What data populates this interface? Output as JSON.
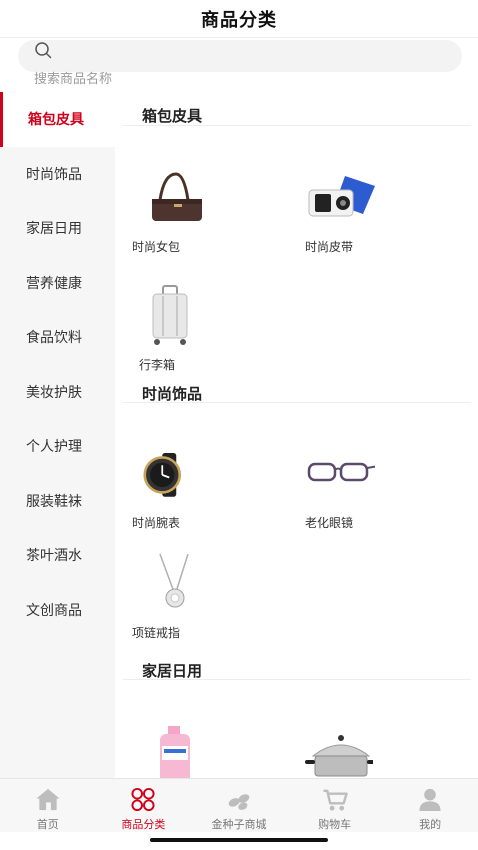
{
  "header": {
    "title": "商品分类"
  },
  "search": {
    "placeholder": "搜索商品名称"
  },
  "sidebar": {
    "items": [
      {
        "label": "箱包皮具",
        "active": true
      },
      {
        "label": "时尚饰品"
      },
      {
        "label": "家居日用"
      },
      {
        "label": "营养健康"
      },
      {
        "label": "食品饮料"
      },
      {
        "label": "美妆护肤"
      },
      {
        "label": "个人护理"
      },
      {
        "label": "服装鞋袜"
      },
      {
        "label": "茶叶酒水"
      },
      {
        "label": "文创商品"
      }
    ]
  },
  "sections": [
    {
      "title": "箱包皮具",
      "products": [
        {
          "label": "时尚女包",
          "icon": "handbag-icon"
        },
        {
          "label": "时尚皮带",
          "icon": "belt-icon"
        },
        {
          "label": "行李箱",
          "icon": "suitcase-icon"
        }
      ]
    },
    {
      "title": "时尚饰品",
      "products": [
        {
          "label": "时尚腕表",
          "icon": "watch-icon"
        },
        {
          "label": "老化眼镜",
          "icon": "glasses-icon"
        },
        {
          "label": "项链戒指",
          "icon": "necklace-icon"
        }
      ]
    },
    {
      "title": "家居日用",
      "products": [
        {
          "label": "",
          "icon": "detergent-bottle-icon"
        },
        {
          "label": "",
          "icon": "steamer-pot-icon"
        }
      ]
    }
  ],
  "tabbar": {
    "items": [
      {
        "label": "首页",
        "icon": "home-icon"
      },
      {
        "label": "商品分类",
        "icon": "category-icon",
        "active": true
      },
      {
        "label": "金种子商城",
        "icon": "seeds-icon"
      },
      {
        "label": "购物车",
        "icon": "cart-icon"
      },
      {
        "label": "我的",
        "icon": "user-icon"
      }
    ]
  },
  "colors": {
    "accent": "#d0021b",
    "sidebar_bg": "#f6f6f6",
    "tab_inactive": "#bdbdbd"
  }
}
